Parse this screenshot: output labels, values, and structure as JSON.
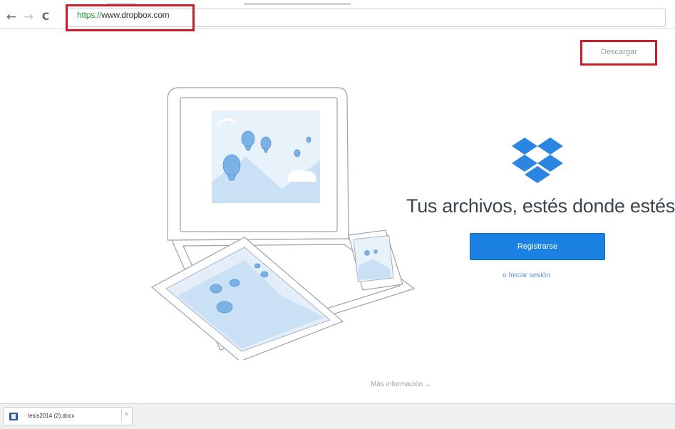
{
  "browser": {
    "url_scheme": "https://",
    "url_rest": "www.dropbox.com",
    "nav": {
      "back_icon": "←",
      "forward_icon": "→",
      "reload_icon": "C"
    }
  },
  "header": {
    "download_label": "Descargar"
  },
  "hero": {
    "headline": "Tus archivos, estés donde estés",
    "register_label": "Registrarse",
    "signin_label": "o Iniciar sesión"
  },
  "footer": {
    "more_info_label": "Más información ⌄"
  },
  "download_shelf": {
    "file_name": "tesis2014 (2).docx"
  },
  "colors": {
    "brand_blue": "#1b81e3",
    "highlight_red": "#c8202a",
    "logo_blue": "#2a86e0"
  }
}
